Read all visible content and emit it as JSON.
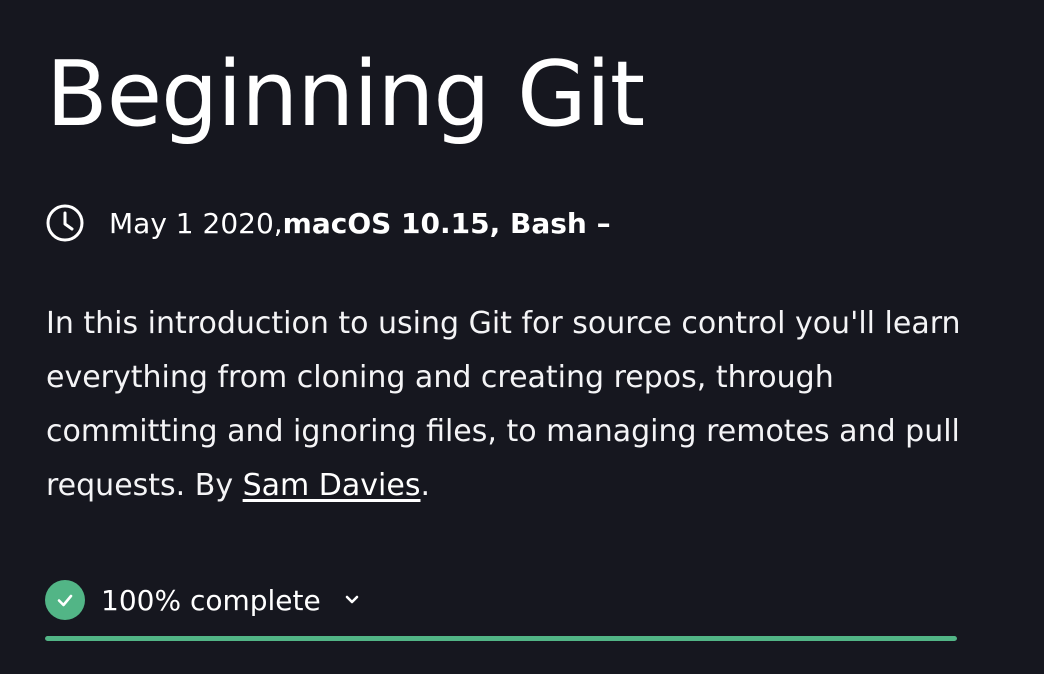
{
  "course": {
    "title": "Beginning Git",
    "date": "May 1 2020, ",
    "platforms": "macOS 10.15, Bash –",
    "description_text": "In this introduction to using Git for source control you'll learn everything from cloning and creating repos, through committing and ignoring files, to managing remotes and pull requests. By ",
    "author": "Sam Davies",
    "description_end": "."
  },
  "progress": {
    "label": "100% complete",
    "fraction": 1.0,
    "color": "#52b586"
  },
  "icons": {
    "clock": "clock-icon",
    "check": "check-icon",
    "chevron": "chevron-down-icon"
  }
}
